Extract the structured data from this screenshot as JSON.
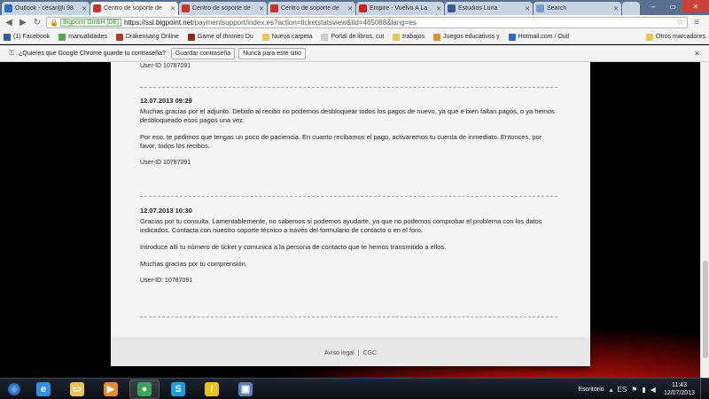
{
  "browser": {
    "tabs": [
      {
        "label": "Outlook - cesar@i 98",
        "color": "#2b6cc4",
        "active": false
      },
      {
        "label": "Centro de soporte de",
        "color": "#c8332b",
        "active": true
      },
      {
        "label": "Centro de soporte de",
        "color": "#c8332b",
        "active": false
      },
      {
        "label": "Centro de soporte de",
        "color": "#c8332b",
        "active": false
      },
      {
        "label": "Empire - Vuelvo A La",
        "color": "#d61e1e",
        "active": false
      },
      {
        "label": "Estudios Luna",
        "color": "#3b5998",
        "active": false
      },
      {
        "label": "Search",
        "color": "#7a9bd0",
        "active": false
      }
    ],
    "omnibox": {
      "ev_badge": "Bigpoint GmbH [DE]",
      "url_host": "https://ssl.bigpoint.net",
      "url_path": "/paymentsupport/index.es?action=ticketstatsview&tid=465088&lang=es"
    },
    "bookmarks": [
      {
        "label": "(1) Facebook",
        "color": "#3b5998",
        "folder": false
      },
      {
        "label": "manualidades",
        "color": "#5aa84a",
        "folder": false
      },
      {
        "label": "Drakensang Online",
        "color": "#b03a2e",
        "folder": false
      },
      {
        "label": "Game of thrones Du",
        "color": "#8a2b1b",
        "folder": false
      },
      {
        "label": "Nueva carpeta",
        "color": "#e7c65a",
        "folder": true
      },
      {
        "label": "Portal de libros, cut",
        "color": "#cccccc",
        "folder": false
      },
      {
        "label": "trabajos",
        "color": "#e7c65a",
        "folder": true
      },
      {
        "label": "Juegos educativos y",
        "color": "#e09030",
        "folder": false
      },
      {
        "label": "Hotmail.com / Outl",
        "color": "#2b6cc4",
        "folder": false
      }
    ],
    "other_bookmarks": "Otros marcadores",
    "infobar": {
      "question": "¿Quieres que Google Chrome guarde tu contraseña?",
      "save": "Guardar contraseña",
      "never": "Nunca para este sitio"
    }
  },
  "page": {
    "top_user_id": "User-ID 10787091",
    "messages": [
      {
        "date": "12.07.2013 09:29",
        "paragraphs": [
          "Muchas gracias por el adjunto. Debido al recibo no podemos desbloquear todos los pagos de nuevo, ya que e bien faltan pagos, o ya hemos desbloqueado esos pagos una vez.",
          "Por eso, te pedimos que tengas un poco de paciencia. En cuanto recibamos el pago, activaremos tu cuenta de inmediato. Entonces, por favor, todos los recibos."
        ],
        "user_id": "User-ID 10787091"
      },
      {
        "date": "12.07.2013 10:30",
        "paragraphs": [
          "Gracias por tu consulta. Lamentablemente, no sabemos si podemos ayudarte, ya que no podemos comprobar el problema con los datos indicados. Contacta con nuestro soporte técnico a través del formulario de contacto o en el foro.",
          "Introduce allí tu número de ticket y comunica a la persona de contacto que te hemos transmitido a ellos.",
          "Muchas gracias por tu comprensión."
        ],
        "user_id": "User-ID: 10787091"
      }
    ],
    "footer": {
      "legal": "Aviso legal",
      "divider": "|",
      "terms": "CGC"
    }
  },
  "taskbar": {
    "apps": [
      {
        "icon": "internet-explorer-icon",
        "glyph": "e",
        "color": "#2f8fe0",
        "open": false
      },
      {
        "icon": "file-explorer-icon",
        "glyph": "▭",
        "color": "#e7c65a",
        "open": false
      },
      {
        "icon": "media-player-icon",
        "glyph": "▶",
        "color": "#e88a2a",
        "open": false
      },
      {
        "icon": "chrome-icon",
        "glyph": "●",
        "color": "#3aa55a",
        "open": true
      },
      {
        "icon": "skype-icon",
        "glyph": "S",
        "color": "#18a0e0",
        "open": false
      },
      {
        "icon": "warning-app-icon",
        "glyph": "!",
        "color": "#e8c11a",
        "open": false
      },
      {
        "icon": "window-app-icon",
        "glyph": "▣",
        "color": "#5b7fb8",
        "open": false
      }
    ],
    "desktop_label": "Escritorio",
    "language": "ES",
    "time": "11:43",
    "date": "12/07/2013"
  }
}
